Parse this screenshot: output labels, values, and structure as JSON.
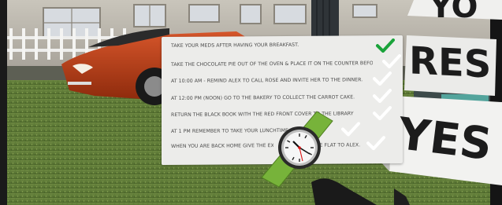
{
  "tasks": [
    {
      "text": "TAKE YOUR MEDS AFTER HAVING YOUR BREAKFAST.",
      "status": "done"
    },
    {
      "text": "TAKE THE CHOCOLATE PIE OUT OF THE OVEN & PLACE IT ON THE COUNTER BEFORE GOING OUT.",
      "status": "pending"
    },
    {
      "text": "AT 10:00 AM - REMIND ALEX TO CALL ROSE AND INVITE HER TO THE DINNER.",
      "status": "pending"
    },
    {
      "text": "AT 12:00 PM (NOON) GO TO THE BAKERY TO COLLECT THE CARROT CAKE.",
      "status": "pending"
    },
    {
      "text": "RETURN THE BLACK BOOK WITH THE RED FRONT COVER TO THE LIBRARY",
      "status": "pending"
    },
    {
      "text": "AT 1 PM REMEMBER TO TAKE YOUR LUNCHTIME",
      "status": "pending"
    },
    {
      "text": "WHEN YOU ARE BACK HOME GIVE THE EX",
      "text_end": "THE FLAT TO ALEX.",
      "status": "pending"
    }
  ],
  "signs": {
    "top_partial": "YO",
    "middle_partial": "RES",
    "yes": "YES"
  },
  "colors": {
    "done_check": "#1aa33a",
    "pending_check": "#ffffff",
    "watch_band": "#77b33a",
    "car": "#b03a14"
  },
  "icons": {
    "done": "checkmark-icon",
    "pending": "checkmark-icon",
    "watch": "analog-clock-icon"
  }
}
